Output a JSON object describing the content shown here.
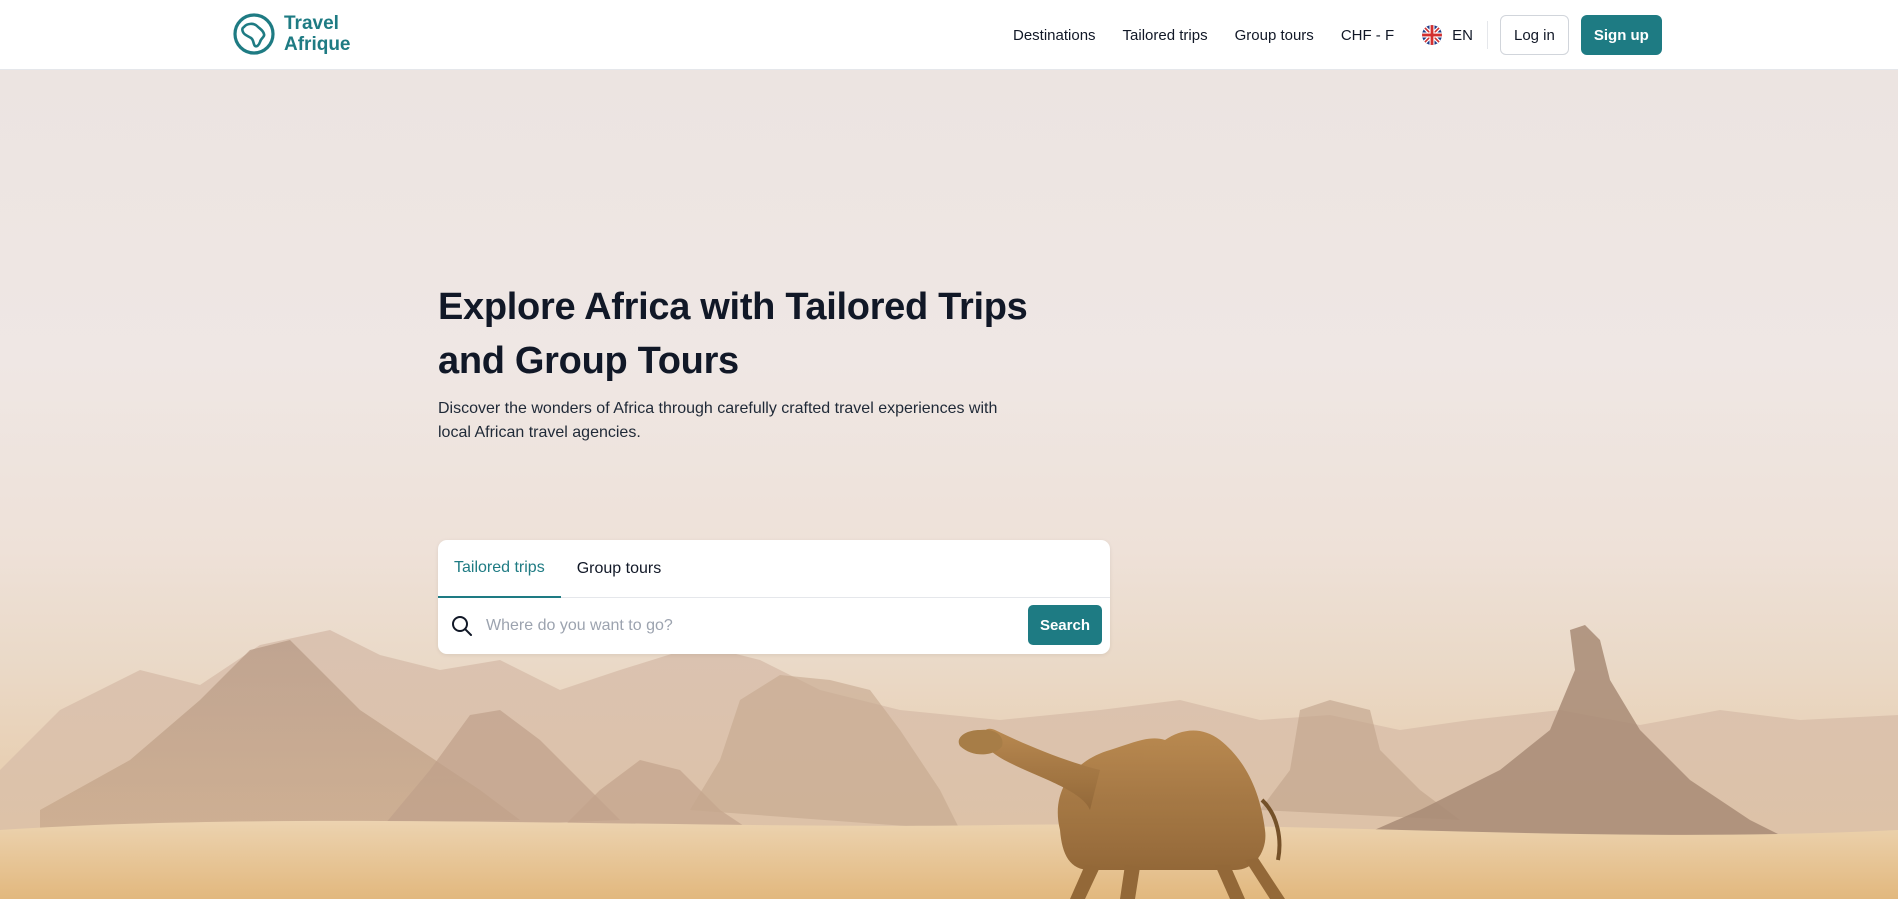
{
  "brand": {
    "line1": "Travel",
    "line2": "Afrique",
    "color": "#1e7b83"
  },
  "nav": {
    "items": [
      {
        "label": "Destinations"
      },
      {
        "label": "Tailored trips"
      },
      {
        "label": "Group tours"
      },
      {
        "label": "CHF - F"
      }
    ],
    "language": {
      "code": "EN",
      "icon": "uk-flag-icon"
    },
    "login_label": "Log in",
    "signup_label": "Sign up"
  },
  "hero": {
    "title": "Explore Africa with Tailored Trips and Group Tours",
    "subtitle": "Discover the wonders of Africa through carefully crafted travel experiences with local African travel agencies.",
    "background": "desert-camel-photo"
  },
  "search": {
    "tabs": [
      {
        "label": "Tailored trips",
        "active": true
      },
      {
        "label": "Group tours",
        "active": false
      }
    ],
    "placeholder": "Where do you want to go?",
    "button_label": "Search",
    "icon": "search-icon"
  },
  "colors": {
    "accent": "#1e7b83",
    "text": "#111827"
  }
}
